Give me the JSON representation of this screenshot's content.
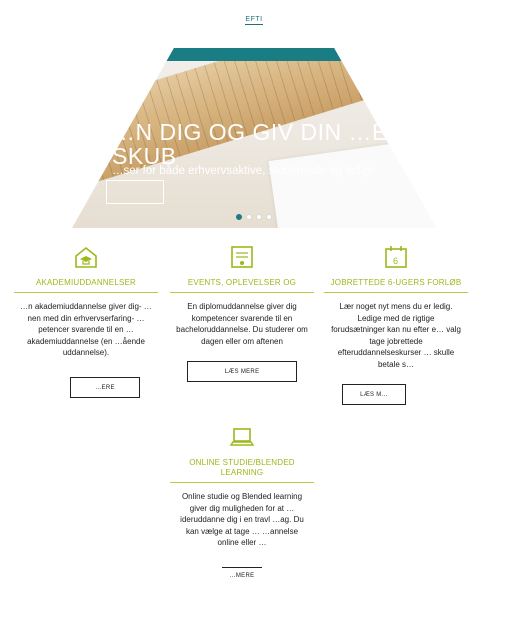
{
  "nav": {
    "label": "EFTI"
  },
  "hero": {
    "title": "…N DIG OG GIV DIN …ET SKUB",
    "subtitle": "…ser for både erhvervsaktive, studerende og ledige",
    "slides": 4,
    "active_slide": 1,
    "accent": "#1a7d84"
  },
  "cards": [
    {
      "icon": "graduation-cap-house-icon",
      "title": "AKADEMIUDDANNELSER",
      "text": "…n akademiuddannelse giver dig- …nen med din erhvervserfaring- …petencer svarende til en …akademiuddannelse (en …ående uddannelse).",
      "button": "…ERE"
    },
    {
      "icon": "certificate-icon",
      "title": "EVENTS, OPLEVELSER OG",
      "text": "En diplomuddannelse giver dig kompetencer svarende til en bacheloruddannelse. Du studerer om dagen eller om aftenen",
      "button": "LÆS MERE"
    },
    {
      "icon": "calendar-6-icon",
      "title": "JOBRETTEDE 6-UGERS FORLØB",
      "text": "Lær noget nyt mens du er ledig. Ledige med de rigtige forudsætninger kan nu efter e… valg tage jobrettede efteruddannelseskurser … skulle betale s…",
      "button": "LÆS M…"
    },
    {
      "icon": "laptop-icon",
      "title": "ONLINE STUDIE/BLENDED LEARNING",
      "text": "Online studie og Blended learning giver dig muligheden for at …ideruddanne dig i en travl …ag. Du kan vælge at tage … …annelse online eller …",
      "button": "…MERE"
    }
  ],
  "colors": {
    "green": "#9ab91a",
    "teal": "#1a7d84"
  }
}
